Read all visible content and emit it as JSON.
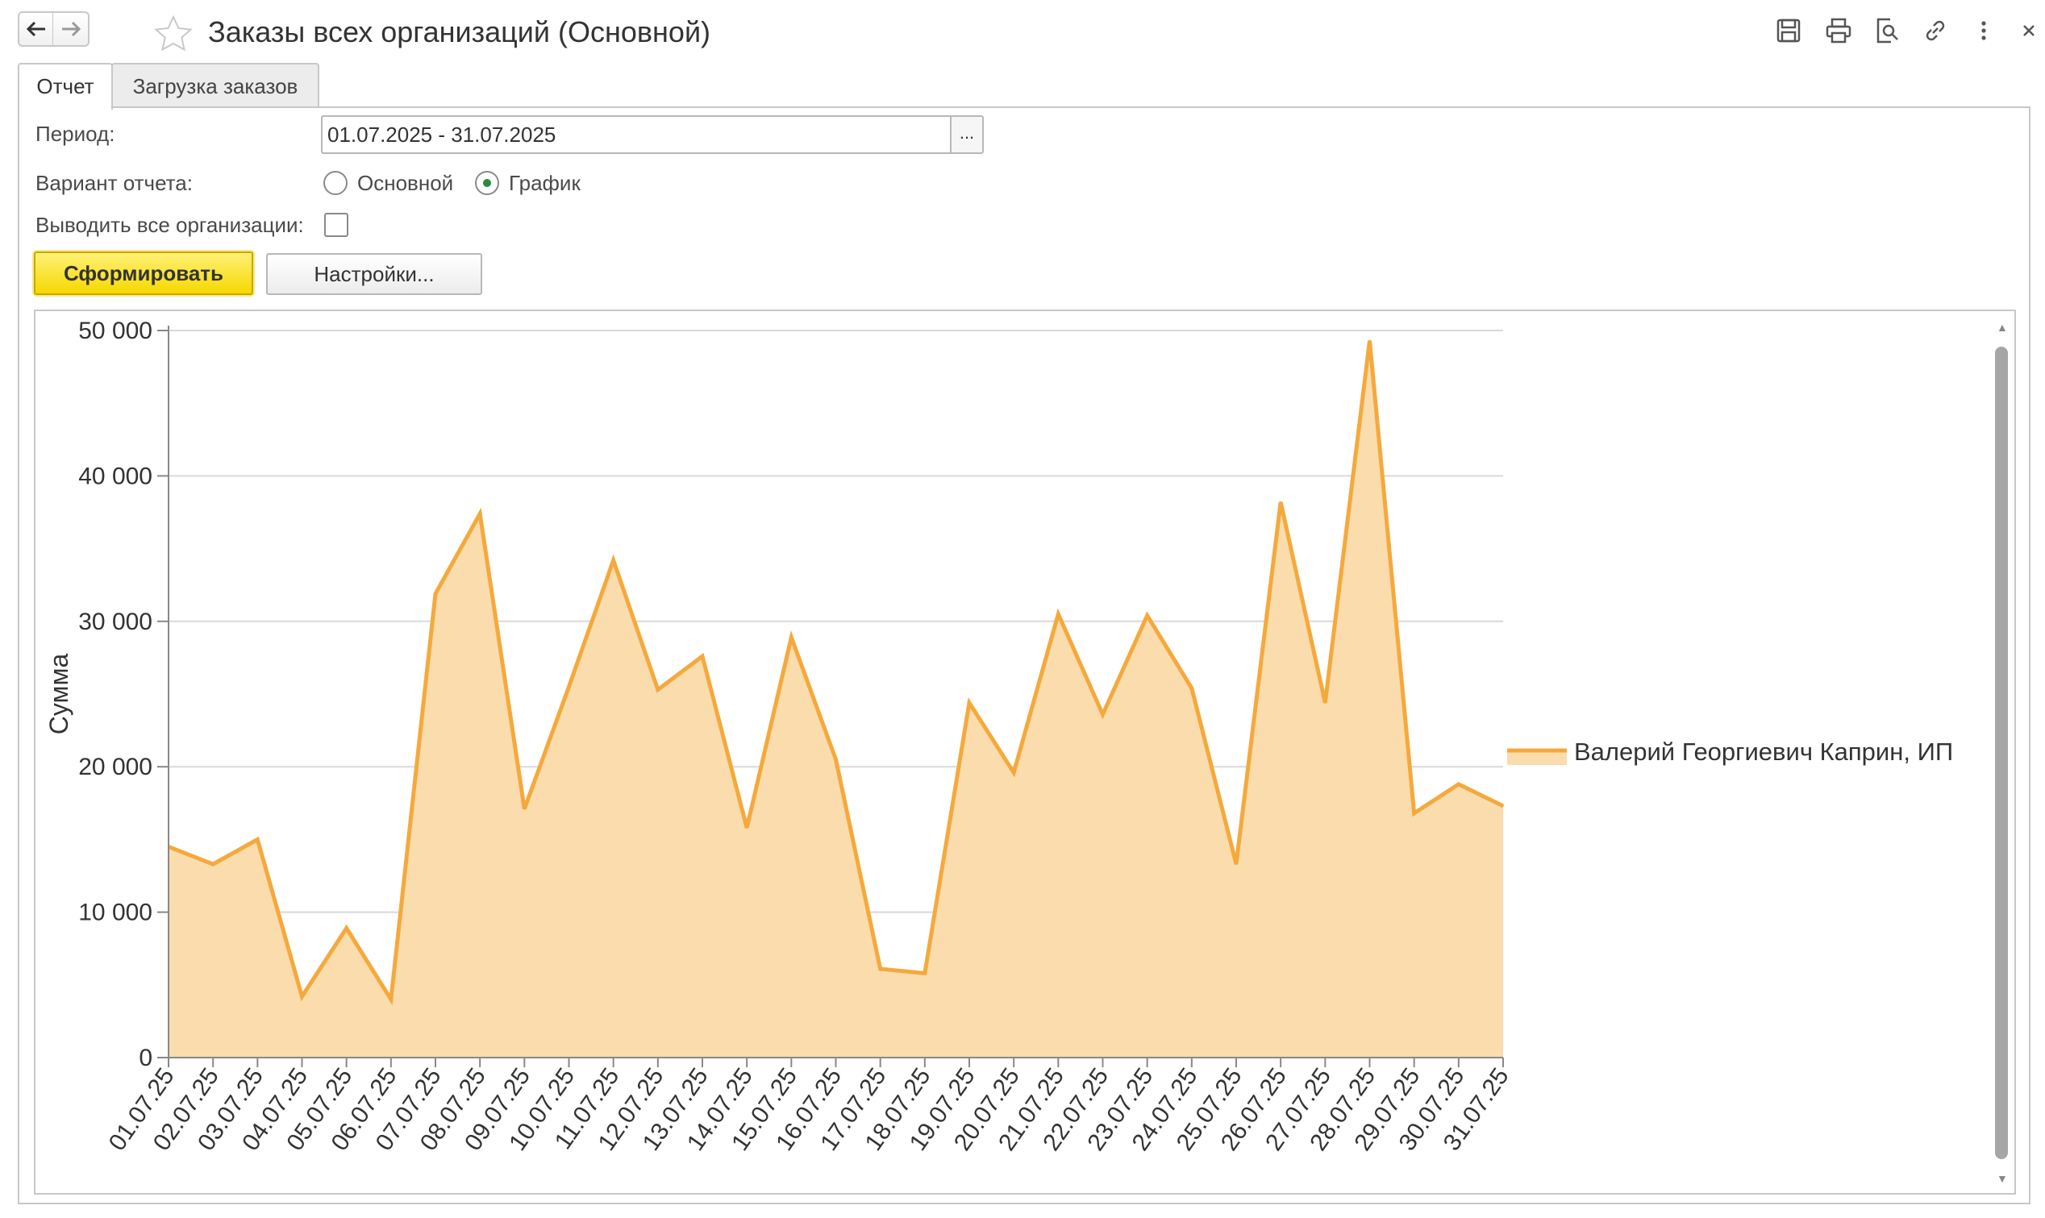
{
  "window": {
    "title": "Заказы всех организаций (Основной)",
    "toolbar_icons": [
      "back-arrow-icon",
      "forward-arrow-icon",
      "star-icon",
      "save-icon",
      "print-icon",
      "preview-icon",
      "link-icon",
      "more-icon",
      "close-icon"
    ]
  },
  "tabs": [
    {
      "label": "Отчет",
      "active": true
    },
    {
      "label": "Загрузка заказов",
      "active": false
    }
  ],
  "form": {
    "period_label": "Период:",
    "period_value": "01.07.2025 - 31.07.2025",
    "period_button": "...",
    "variant_label": "Вариант отчета:",
    "variant_options": [
      {
        "label": "Основной",
        "selected": false
      },
      {
        "label": "График",
        "selected": true
      }
    ],
    "all_orgs_label": "Выводить все организации:",
    "all_orgs_checked": false,
    "generate_button": "Сформировать",
    "settings_button": "Настройки..."
  },
  "colors": {
    "accent_yellow": "#f5d800",
    "series_line": "#f5a93c",
    "series_fill": "#fadcad",
    "radio_selected": "#2b8a3e"
  },
  "chart_data": {
    "type": "area",
    "title": "",
    "xlabel": "",
    "ylabel": "Сумма",
    "ylim": [
      0,
      50000
    ],
    "yticks": [
      0,
      10000,
      20000,
      30000,
      40000,
      50000
    ],
    "ytick_labels": [
      "0",
      "10 000",
      "20 000",
      "30 000",
      "40 000",
      "50 000"
    ],
    "grid": true,
    "legend_position": "right",
    "categories": [
      "01.07.25",
      "02.07.25",
      "03.07.25",
      "04.07.25",
      "05.07.25",
      "06.07.25",
      "07.07.25",
      "08.07.25",
      "09.07.25",
      "10.07.25",
      "11.07.25",
      "12.07.25",
      "13.07.25",
      "14.07.25",
      "15.07.25",
      "16.07.25",
      "17.07.25",
      "18.07.25",
      "19.07.25",
      "20.07.25",
      "21.07.25",
      "22.07.25",
      "23.07.25",
      "24.07.25",
      "25.07.25",
      "26.07.25",
      "27.07.25",
      "28.07.25",
      "29.07.25",
      "30.07.25",
      "31.07.25"
    ],
    "series": [
      {
        "name": "Валерий Георгиевич Каприн, ИП",
        "values": [
          14500,
          13300,
          15000,
          4200,
          8900,
          4000,
          31900,
          37400,
          17100,
          25500,
          34200,
          25300,
          27600,
          15800,
          28900,
          20500,
          6100,
          5800,
          24400,
          19600,
          30500,
          23600,
          30400,
          25400,
          13300,
          38200,
          24400,
          49300,
          16800,
          18800,
          17300
        ]
      }
    ]
  }
}
